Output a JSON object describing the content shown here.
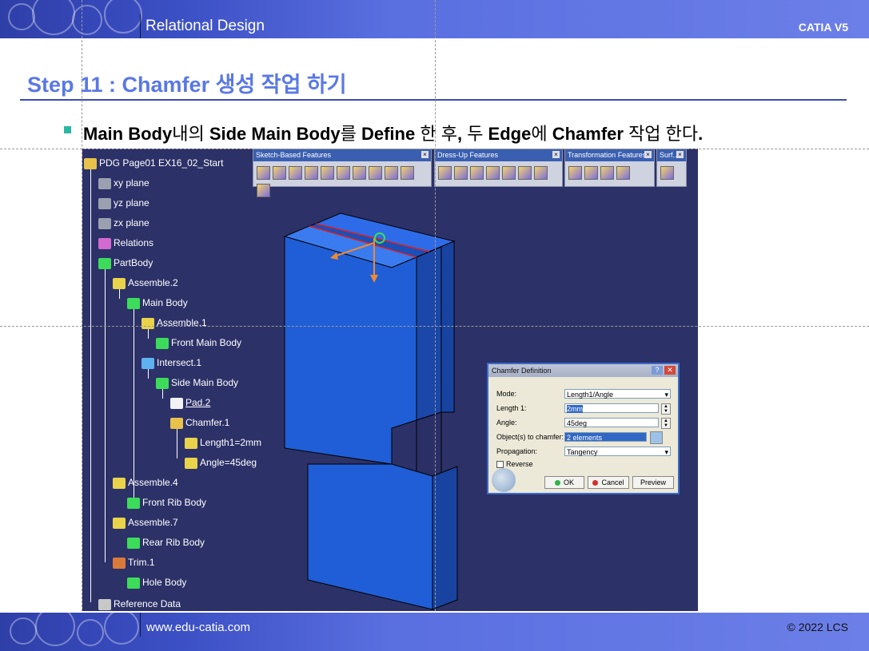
{
  "header": {
    "title": "Relational Design",
    "product": "CATIA V5"
  },
  "footer": {
    "url": "www.edu-catia.com",
    "copyright": "© 2022 LCS"
  },
  "slide": {
    "step_title": "Step 11 : Chamfer 생성 작업 하기",
    "instruction_parts": [
      {
        "text": "Main Body",
        "bold": true
      },
      {
        "text": "내의 ",
        "bold": false
      },
      {
        "text": "Side Main Body",
        "bold": true
      },
      {
        "text": "를 ",
        "bold": false
      },
      {
        "text": "Define",
        "bold": true
      },
      {
        "text": " 한 후",
        "bold": false
      },
      {
        "text": ",",
        "bold": true
      },
      {
        "text": " 두 ",
        "bold": false
      },
      {
        "text": "Edge",
        "bold": true
      },
      {
        "text": "에 ",
        "bold": false
      },
      {
        "text": "Chamfer",
        "bold": true
      },
      {
        "text": " 작업 한다",
        "bold": false
      },
      {
        "text": ".",
        "bold": true
      }
    ]
  },
  "toolbars": [
    {
      "title": "Sketch-Based Features",
      "buttons": 11
    },
    {
      "title": "Dress-Up Features",
      "buttons": 7
    },
    {
      "title": "Transformation Features",
      "buttons": 4
    },
    {
      "title": "Surf...",
      "buttons": 1
    }
  ],
  "tree": [
    {
      "label": "PDG Page01 EX16_02_Start",
      "icon": "product-icon",
      "underline": false
    },
    {
      "label": "xy plane",
      "icon": "plane-icon",
      "underline": false
    },
    {
      "label": "yz plane",
      "icon": "plane-icon",
      "underline": false
    },
    {
      "label": "zx plane",
      "icon": "plane-icon",
      "underline": false
    },
    {
      "label": "Relations",
      "icon": "relations-icon",
      "underline": false
    },
    {
      "label": "PartBody",
      "icon": "body-icon",
      "underline": false
    },
    {
      "label": "Assemble.2",
      "icon": "assemble-icon",
      "underline": false
    },
    {
      "label": "Main Body",
      "icon": "body-icon",
      "underline": false
    },
    {
      "label": "Assemble.1",
      "icon": "assemble-icon",
      "underline": false
    },
    {
      "label": "Front Main Body",
      "icon": "body-icon",
      "underline": false
    },
    {
      "label": "Intersect.1",
      "icon": "intersect-icon",
      "underline": false
    },
    {
      "label": "Side Main Body",
      "icon": "body-icon",
      "underline": false
    },
    {
      "label": "Pad.2",
      "icon": "pad-icon",
      "underline": true
    },
    {
      "label": "Chamfer.1",
      "icon": "chamfer-icon",
      "underline": false
    },
    {
      "label": "Length1=2mm",
      "icon": "parameter-icon",
      "underline": false
    },
    {
      "label": "Angle=45deg",
      "icon": "parameter-icon",
      "underline": false
    },
    {
      "label": "Assemble.4",
      "icon": "assemble-icon",
      "underline": false
    },
    {
      "label": "Front Rib Body",
      "icon": "body-icon",
      "underline": false
    },
    {
      "label": "Assemble.7",
      "icon": "assemble-icon",
      "underline": false
    },
    {
      "label": "Rear Rib Body",
      "icon": "body-icon",
      "underline": false
    },
    {
      "label": "Trim.1",
      "icon": "trim-icon",
      "underline": false
    },
    {
      "label": "Hole Body",
      "icon": "body-icon",
      "underline": false
    },
    {
      "label": "Reference Data",
      "icon": "reference-icon",
      "underline": false
    }
  ],
  "dialog": {
    "title": "Chamfer Definition",
    "mode_label": "Mode:",
    "mode_value": "Length1/Angle",
    "length_label": "Length 1:",
    "length_value": "2mm",
    "angle_label": "Angle:",
    "angle_value": "45deg",
    "objects_label": "Object(s) to chamfer:",
    "objects_value": "2 elements",
    "propagation_label": "Propagation:",
    "propagation_value": "Tangency",
    "reverse_label": "Reverse",
    "ok_label": "OK",
    "cancel_label": "Cancel",
    "preview_label": "Preview"
  },
  "colors": {
    "accent": "#5a78e6",
    "band": "#3b4fc4",
    "viewport": "#2c3168",
    "part": "#1f5ed6"
  }
}
